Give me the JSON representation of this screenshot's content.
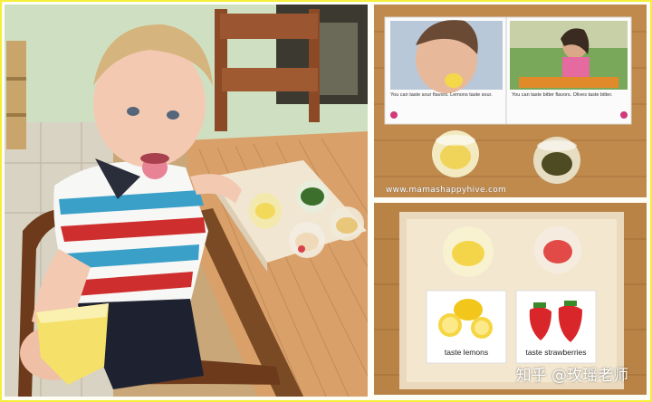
{
  "book": {
    "left_caption": "You can taste sour flavors. Lemons taste sour.",
    "right_caption": "You can taste bitter flavors. Olives taste bitter."
  },
  "site_url": "www.mamashappyhive.com",
  "cards": {
    "lemon_label": "taste lemons",
    "strawberry_label": "taste strawberries"
  },
  "source_watermark": "知乎 @玫瑶老师"
}
